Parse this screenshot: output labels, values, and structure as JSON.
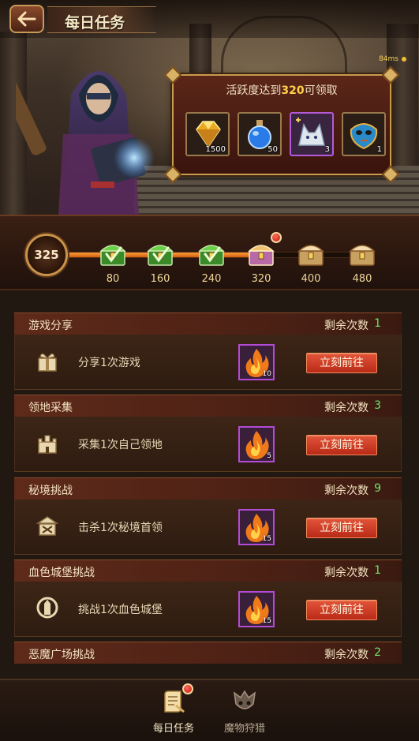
{
  "header": {
    "title": "每日任务",
    "ping": "84ms"
  },
  "reward_panel": {
    "title_prefix": "活跃度达到",
    "title_value": "320",
    "title_suffix": "可领取",
    "items": [
      {
        "icon": "gold-gem-icon",
        "qty": "1500"
      },
      {
        "icon": "blue-potion-icon",
        "qty": "50"
      },
      {
        "icon": "wolf-pet-icon",
        "qty": "3"
      },
      {
        "icon": "blue-mask-icon",
        "qty": "1"
      }
    ]
  },
  "activity": {
    "score": "325",
    "progress_fraction": 0.64,
    "milestones": [
      {
        "value": "80",
        "state": "claimed"
      },
      {
        "value": "160",
        "state": "claimed"
      },
      {
        "value": "240",
        "state": "claimed"
      },
      {
        "value": "320",
        "state": "available"
      },
      {
        "value": "400",
        "state": "locked"
      },
      {
        "value": "480",
        "state": "locked"
      }
    ]
  },
  "tasks": [
    {
      "name": "游戏分享",
      "remaining_label": "剩余次数",
      "count": "1",
      "icon": "gift-icon",
      "desc": "分享1次游戏",
      "reward_qty": "10",
      "button": "立刻前往"
    },
    {
      "name": "领地采集",
      "remaining_label": "剩余次数",
      "count": "3",
      "icon": "castle-icon",
      "desc": "采集1次自己领地",
      "reward_qty": "5",
      "button": "立刻前往"
    },
    {
      "name": "秘境挑战",
      "remaining_label": "剩余次数",
      "count": "9",
      "icon": "temple-icon",
      "desc": "击杀1次秘境首领",
      "reward_qty": "15",
      "button": "立刻前往"
    },
    {
      "name": "血色城堡挑战",
      "remaining_label": "剩余次数",
      "count": "1",
      "icon": "moon-castle-icon",
      "desc": "挑战1次血色城堡",
      "reward_qty": "15",
      "button": "立刻前往"
    },
    {
      "name": "恶魔广场挑战",
      "remaining_label": "剩余次数",
      "count": "2"
    }
  ],
  "nav": {
    "daily_tasks": "每日任务",
    "monster_hunt": "魔物狩猎"
  },
  "colors": {
    "accent_gold": "#c89a4e",
    "count_green": "#6fe36f",
    "button_red": "#c93a24",
    "progress_orange": "#f08a2a"
  }
}
